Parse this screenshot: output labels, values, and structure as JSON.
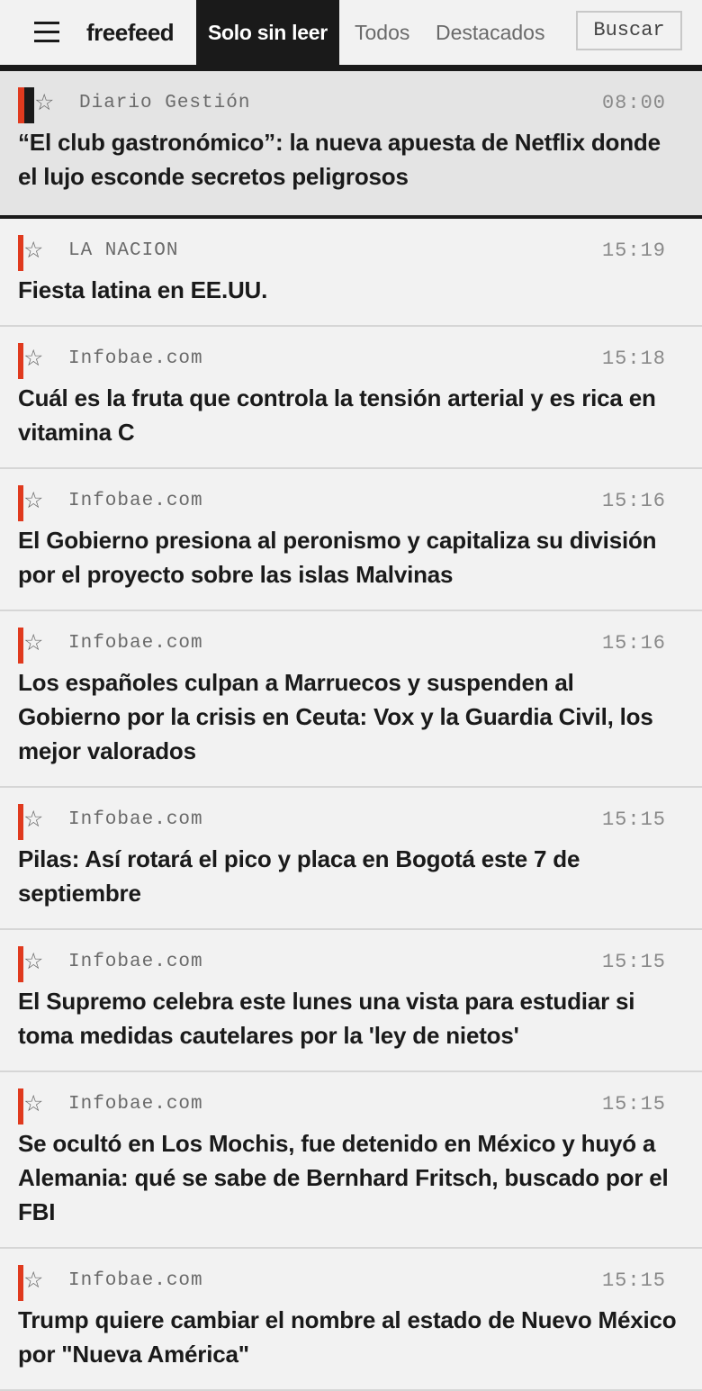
{
  "header": {
    "logo": "freefeed",
    "tabs": [
      {
        "label": "Solo sin leer",
        "active": true
      },
      {
        "label": "Todos",
        "active": false
      },
      {
        "label": "Destacados",
        "active": false
      }
    ],
    "search_label": "Buscar"
  },
  "icons": {
    "menu": "hamburger-menu-icon",
    "star": "star-outline-icon"
  },
  "colors": {
    "accent": "#e03a1e",
    "dark": "#1a1a1a",
    "background": "#f2f2f2",
    "selected_background": "#e4e4e4"
  },
  "items": [
    {
      "source": "Diario Gestión",
      "time": "08:00",
      "title": "“El club gastronómico”: la nueva apuesta de Netflix donde el lujo esconde secretos peligrosos",
      "selected": true
    },
    {
      "source": "LA NACION",
      "time": "15:19",
      "title": "Fiesta latina en EE.UU."
    },
    {
      "source": "Infobae.com",
      "time": "15:18",
      "title": "Cuál es la fruta que controla la tensión arterial y es rica en vitamina C"
    },
    {
      "source": "Infobae.com",
      "time": "15:16",
      "title": "El Gobierno presiona al peronismo y capitaliza su división por el proyecto sobre las islas Malvinas"
    },
    {
      "source": "Infobae.com",
      "time": "15:16",
      "title": "Los españoles culpan a Marruecos y suspenden al Gobierno por la crisis en Ceuta: Vox y la Guardia Civil, los mejor valorados"
    },
    {
      "source": "Infobae.com",
      "time": "15:15",
      "title": "Pilas: Así rotará el pico y placa en Bogotá este 7 de septiembre"
    },
    {
      "source": "Infobae.com",
      "time": "15:15",
      "title": "El Supremo celebra este lunes una vista para estudiar si toma medidas cautelares por la 'ley de nietos'"
    },
    {
      "source": "Infobae.com",
      "time": "15:15",
      "title": "Se ocultó en Los Mochis, fue detenido en México y huyó a Alemania: qué se sabe de Bernhard Fritsch, buscado por el FBI"
    },
    {
      "source": "Infobae.com",
      "time": "15:15",
      "title": "Trump quiere cambiar el nombre al estado de Nuevo México por \"Nueva América\""
    }
  ]
}
